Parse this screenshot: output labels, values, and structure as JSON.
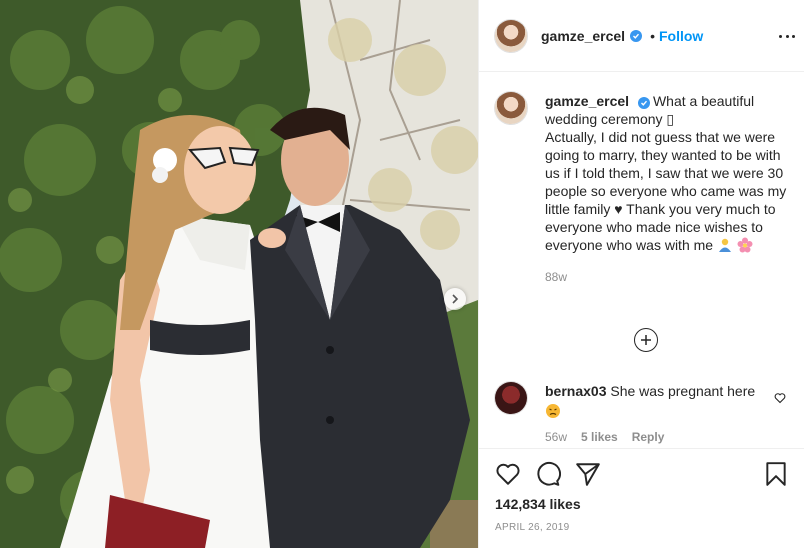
{
  "post": {
    "username": "gamze_ercel",
    "follow_label": "Follow",
    "dot": "•"
  },
  "caption": {
    "username": "gamze_ercel",
    "text_line1": "What a beautiful wedding ceremony ",
    "box_glyph": "▯",
    "text_line2": "Actually, I did not guess that we were going to marry, they wanted to be with us if I told them, I saw that we were 30 people so everyone who came was my little family ",
    "heart_glyph": "♥",
    "text_line3": "  Thank you very much to everyone who made nice wishes to everyone who was with me ",
    "time": "88w"
  },
  "comment": {
    "username": "bernax03",
    "text": "She was pregnant here",
    "time": "56w",
    "likes": "5 likes",
    "reply": "Reply"
  },
  "footer": {
    "likes": "142,834 likes",
    "date": "APRIL 26, 2019"
  },
  "colors": {
    "link": "#0095f6",
    "verified": "#3897f0",
    "text": "#262626",
    "muted": "#8e8e8e"
  },
  "icons": {
    "header_more": "more-options-icon",
    "verified": "verified-badge-icon",
    "load_more": "plus-circle-icon",
    "like": "heart-outline-icon",
    "comment": "comment-bubble-icon",
    "share": "paper-plane-icon",
    "save": "bookmark-icon",
    "next": "chevron-right-icon"
  }
}
